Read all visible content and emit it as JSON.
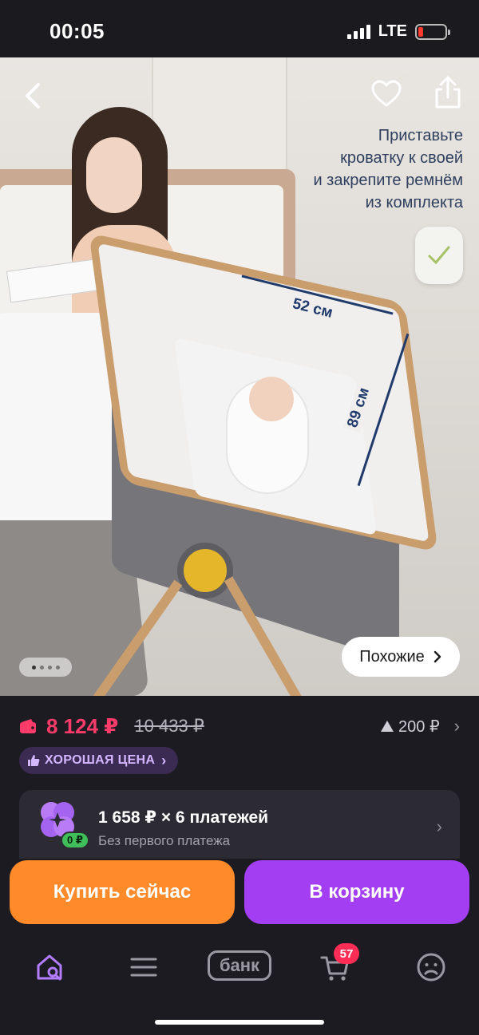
{
  "status_bar": {
    "time": "00:05",
    "network": "LTE"
  },
  "photo": {
    "caption_lines": [
      "Приставьте",
      "кроватку к своей",
      "и закрепите ремнём",
      "из комплекта"
    ],
    "width_label": "52 см",
    "length_label": "89 см",
    "similar_label": "Похожие",
    "dots_count": 4,
    "active_dot": 1
  },
  "price": {
    "current": "8 124 ₽",
    "old": "10 433 ₽",
    "bonus": "200 ₽",
    "current_color": "#ff3b6a"
  },
  "badge": {
    "good_price": "ХОРОШАЯ ЦЕНА"
  },
  "installment": {
    "title": "1 658 ₽ × 6 платежей",
    "subtitle": "Без первого платежа",
    "zero_badge": "0 ₽"
  },
  "actions": {
    "buy_now": "Купить сейчас",
    "add_to_cart": "В корзину",
    "buy_color": "#ff8a2a",
    "cart_color": "#a33ef2"
  },
  "tabbar": {
    "items": [
      "home-search-icon",
      "menu-icon",
      "bank",
      "cart-icon",
      "profile-icon"
    ],
    "bank_label": "банк",
    "cart_count": "57"
  }
}
